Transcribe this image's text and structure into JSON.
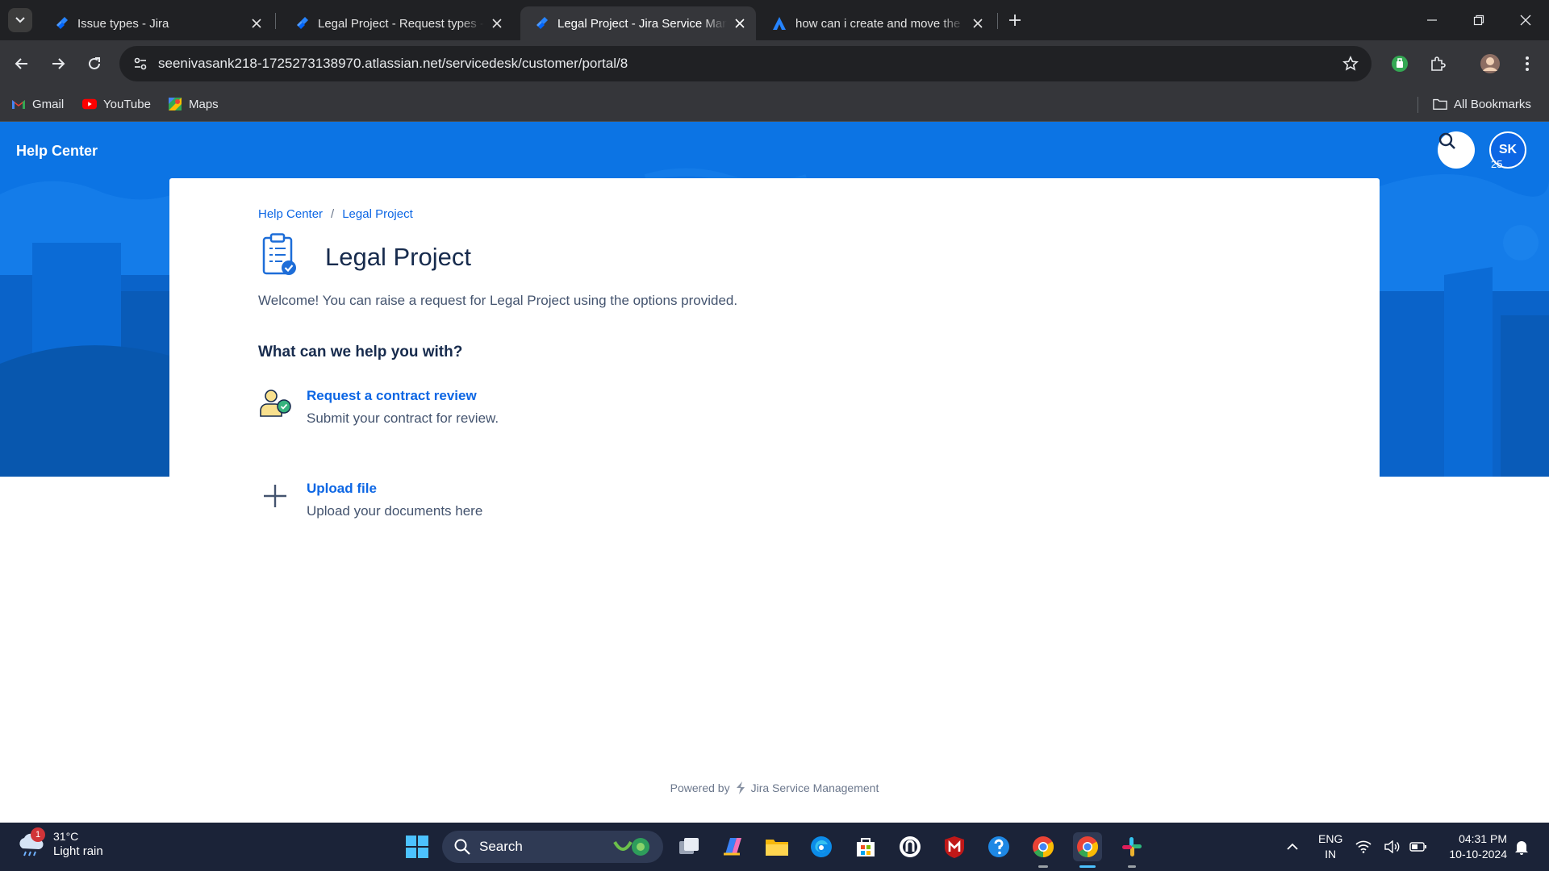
{
  "browser": {
    "tabs": [
      {
        "title": "Issue types - Jira",
        "active": false
      },
      {
        "title": "Legal Project - Request types - Service Management",
        "active": false
      },
      {
        "title": "Legal Project - Jira Service Management",
        "active": true
      },
      {
        "title": "how can i create and move the",
        "active": false
      }
    ],
    "url": "seenivasank218-1725273138970.atlassian.net/servicedesk/customer/portal/8",
    "bookmarks": [
      {
        "label": "Gmail",
        "icon": "gmail-icon"
      },
      {
        "label": "YouTube",
        "icon": "youtube-icon"
      },
      {
        "label": "Maps",
        "icon": "maps-icon"
      }
    ],
    "all_bookmarks_label": "All Bookmarks"
  },
  "portal": {
    "header_title": "Help Center",
    "avatar_initials": "SK",
    "avatar_count": "25",
    "breadcrumb": [
      "Help Center",
      "Legal Project"
    ],
    "project_title": "Legal Project",
    "welcome_text": "Welcome! You can raise a request for Legal Project using the options provided.",
    "help_heading": "What can we help you with?",
    "request_types": [
      {
        "name": "Request a contract review",
        "description": "Submit your contract for review.",
        "icon": "contract-review-icon"
      },
      {
        "name": "Upload file",
        "description": "Upload your documents here",
        "icon": "plus-icon"
      }
    ],
    "powered_by": "Powered by",
    "powered_product": "Jira Service Management"
  },
  "taskbar": {
    "weather_badge": "1",
    "temperature": "31°C",
    "condition": "Light rain",
    "search_label": "Search",
    "lang_line1": "ENG",
    "lang_line2": "IN",
    "time": "04:31 PM",
    "date": "10-10-2024"
  },
  "colors": {
    "brand_blue": "#0c66e4",
    "banner_blue": "#0c74e4",
    "text_dark": "#172b4d",
    "text_muted": "#44546f",
    "taskbar_bg": "#1b2338"
  }
}
